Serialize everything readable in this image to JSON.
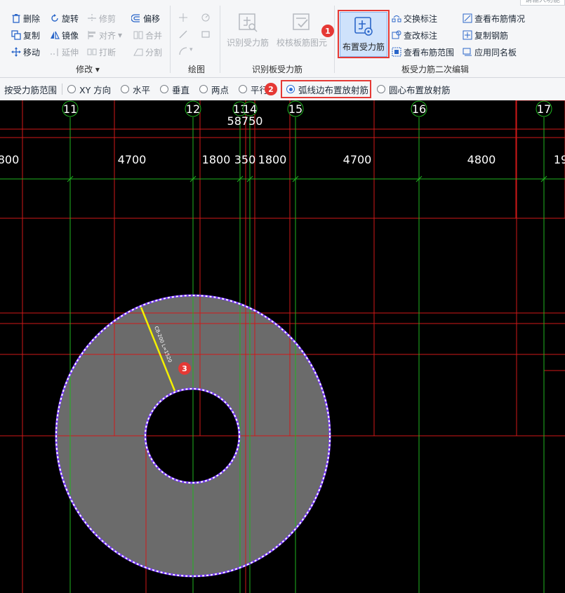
{
  "ribbon": {
    "search_tip": "请输入功能",
    "modify": {
      "group_label": "修改",
      "group_arrow": "▾",
      "items": [
        {
          "label": "删除",
          "icon": "trash-icon",
          "enabled": true
        },
        {
          "label": "旋转",
          "icon": "rotate-icon",
          "enabled": true
        },
        {
          "label": "修剪",
          "icon": "trim-icon",
          "enabled": false
        },
        {
          "label": "偏移",
          "icon": "offset-icon",
          "enabled": true
        },
        {
          "label": "复制",
          "icon": "copy-icon",
          "enabled": true
        },
        {
          "label": "镜像",
          "icon": "mirror-icon",
          "enabled": true
        },
        {
          "label": "对齐",
          "icon": "align-icon",
          "enabled": false
        },
        {
          "label": "合并",
          "icon": "merge-icon",
          "enabled": false
        },
        {
          "label": "移动",
          "icon": "move-icon",
          "enabled": true
        },
        {
          "label": "延伸",
          "icon": "extend-icon",
          "enabled": false
        },
        {
          "label": "打断",
          "icon": "break-icon",
          "enabled": false
        },
        {
          "label": "分割",
          "icon": "split-icon",
          "enabled": false
        }
      ]
    },
    "draw": {
      "group_label": "绘图"
    },
    "identify": {
      "group_label": "识别板受力筋",
      "btn1": "识别受力筋",
      "btn2": "校核板筋图元"
    },
    "secondary": {
      "group_label": "板受力筋二次编辑",
      "main_btn": "布置受力筋",
      "items": [
        {
          "label": "交换标注",
          "icon": "swap-label-icon"
        },
        {
          "label": "查看布筋情况",
          "icon": "view-rebar-icon"
        },
        {
          "label": "查改标注",
          "icon": "edit-label-icon"
        },
        {
          "label": "复制钢筋",
          "icon": "copy-rebar-icon"
        },
        {
          "label": "查看布筋范围",
          "icon": "view-range-icon"
        },
        {
          "label": "应用同名板",
          "icon": "apply-same-icon"
        }
      ]
    }
  },
  "options": {
    "title": "按受力筋范围",
    "radios": [
      {
        "label": "XY 方向",
        "checked": false
      },
      {
        "label": "水平",
        "checked": false
      },
      {
        "label": "垂直",
        "checked": false
      },
      {
        "label": "两点",
        "checked": false
      },
      {
        "label": "平行",
        "checked": false
      },
      {
        "label": "弧线边布置放射筋",
        "checked": true
      },
      {
        "label": "圆心布置放射筋",
        "checked": false
      }
    ]
  },
  "badges": {
    "b1": "1",
    "b2": "2",
    "b3": "3"
  },
  "drawing": {
    "total_dimension": "58750",
    "axes": [
      {
        "label": "11"
      },
      {
        "label": "12"
      },
      {
        "label": "13"
      },
      {
        "label": "14"
      },
      {
        "label": "15"
      },
      {
        "label": "16"
      },
      {
        "label": "17"
      }
    ],
    "spacings": [
      "800",
      "4700",
      "1800",
      "350",
      "1800",
      "4700",
      "4800",
      "19"
    ],
    "rebar_label": "C8-200 L=1520"
  },
  "colors": {
    "highlight": "#e53935",
    "axis": "#1fb51f",
    "grid": "#d01818",
    "slab": "#6b6b6b",
    "rebar": "#f4f000",
    "edge": "#7a3cff"
  }
}
